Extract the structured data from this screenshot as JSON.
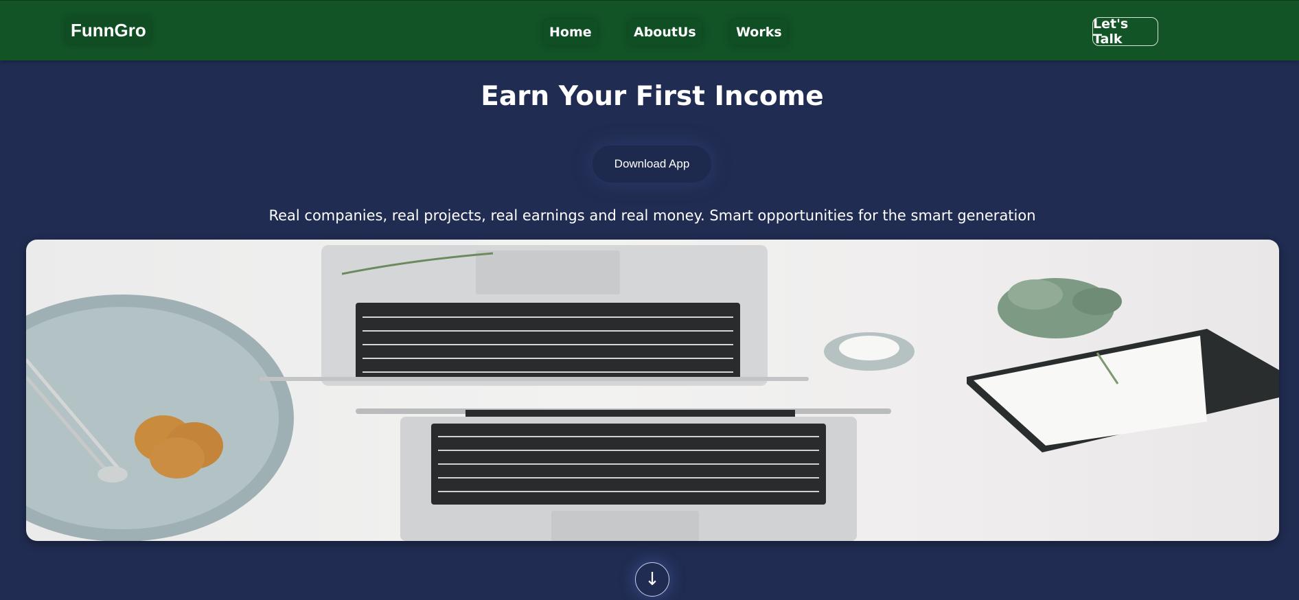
{
  "navbar": {
    "brand": "FunnGro",
    "links": [
      {
        "label": "Home"
      },
      {
        "label": "AboutUs"
      },
      {
        "label": "Works"
      }
    ],
    "cta_label": "Let's Talk",
    "background": "#125426"
  },
  "hero": {
    "title": "Earn Your First Income",
    "download_label": "Download App",
    "tagline": "Real companies, real projects, real earnings and real money. Smart opportunities for the smart generation",
    "background": "#202c51"
  },
  "scroll": {
    "icon": "arrow-down-icon",
    "glyph": "↓"
  }
}
